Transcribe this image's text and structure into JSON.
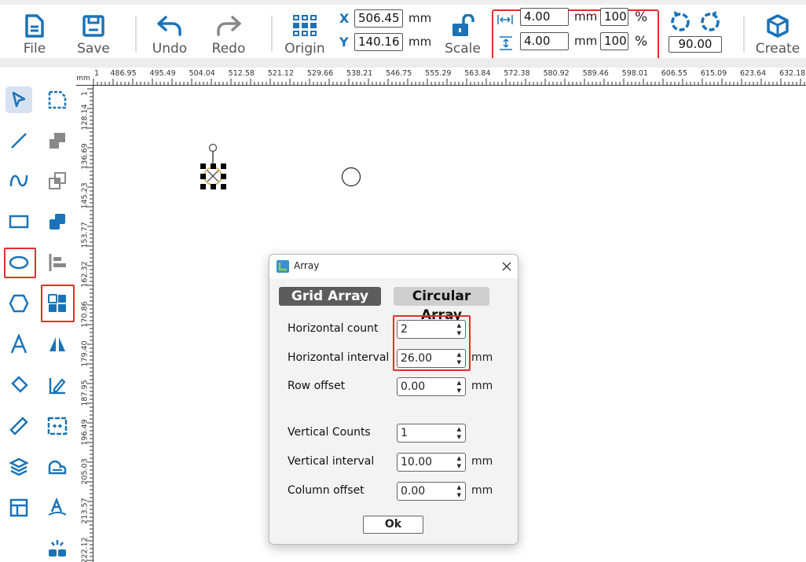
{
  "toolbar": {
    "file": "File",
    "save": "Save",
    "undo": "Undo",
    "redo": "Redo",
    "origin": "Origin",
    "x_label": "X",
    "y_label": "Y",
    "x_value": "506.45",
    "y_value": "140.16",
    "xy_unit": "mm",
    "scale": "Scale",
    "width_value": "4.00",
    "height_value": "4.00",
    "size_unit": "mm",
    "width_percent": "100",
    "height_percent": "100",
    "percent_sign": "%",
    "rotate_value": "90.00",
    "create": "Create"
  },
  "ruler": {
    "unit": "mm",
    "h_first": "1",
    "h_labels": [
      "486.95",
      "495.49",
      "504.04",
      "512.58",
      "521.12",
      "529.66",
      "538.21",
      "546.75",
      "555.29",
      "563.84",
      "572.38",
      "580.92",
      "589.46",
      "598.01",
      "606.55",
      "615.09",
      "623.64",
      "632.18"
    ],
    "v_first": "1",
    "v_labels": [
      "128.14",
      "136.69",
      "145.23",
      "153.77",
      "162.32",
      "170.86",
      "179.40",
      "187.95",
      "196.49",
      "205.03",
      "213.57",
      "222.12"
    ]
  },
  "tools": {
    "left": [
      "select-icon",
      "line-icon",
      "curve-icon",
      "rectangle-icon",
      "ellipse-icon",
      "polygon-icon",
      "text-icon",
      "eraser-icon",
      "ruler-icon",
      "layers-icon",
      "layout-icon"
    ],
    "right": [
      "crop-corner-icon",
      "union-icon",
      "intersect-icon",
      "combine-icon",
      "align-left-icon",
      "array-icon",
      "mirror-icon",
      "edit-node-icon",
      "fit-icon",
      "contour-icon",
      "text-on-path-icon",
      "explode-icon"
    ]
  },
  "dialog": {
    "title": "Array",
    "tab_grid": "Grid Array",
    "tab_circular": "Circular Array",
    "rows": [
      {
        "label": "Horizontal count",
        "value": "2",
        "unit": ""
      },
      {
        "label": "Horizontal interval",
        "value": "26.00",
        "unit": "mm"
      },
      {
        "label": "Row offset",
        "value": "0.00",
        "unit": "mm"
      },
      {
        "label": "Vertical Counts",
        "value": "1",
        "unit": ""
      },
      {
        "label": "Vertical interval",
        "value": "10.00",
        "unit": "mm"
      },
      {
        "label": "Column offset",
        "value": "0.00",
        "unit": "mm"
      }
    ],
    "ok": "Ok"
  },
  "colors": {
    "accent": "#1a73b8",
    "highlight": "#e0302a",
    "tab_active": "#5c5c5c",
    "tab_inactive": "#cfcfcf"
  }
}
